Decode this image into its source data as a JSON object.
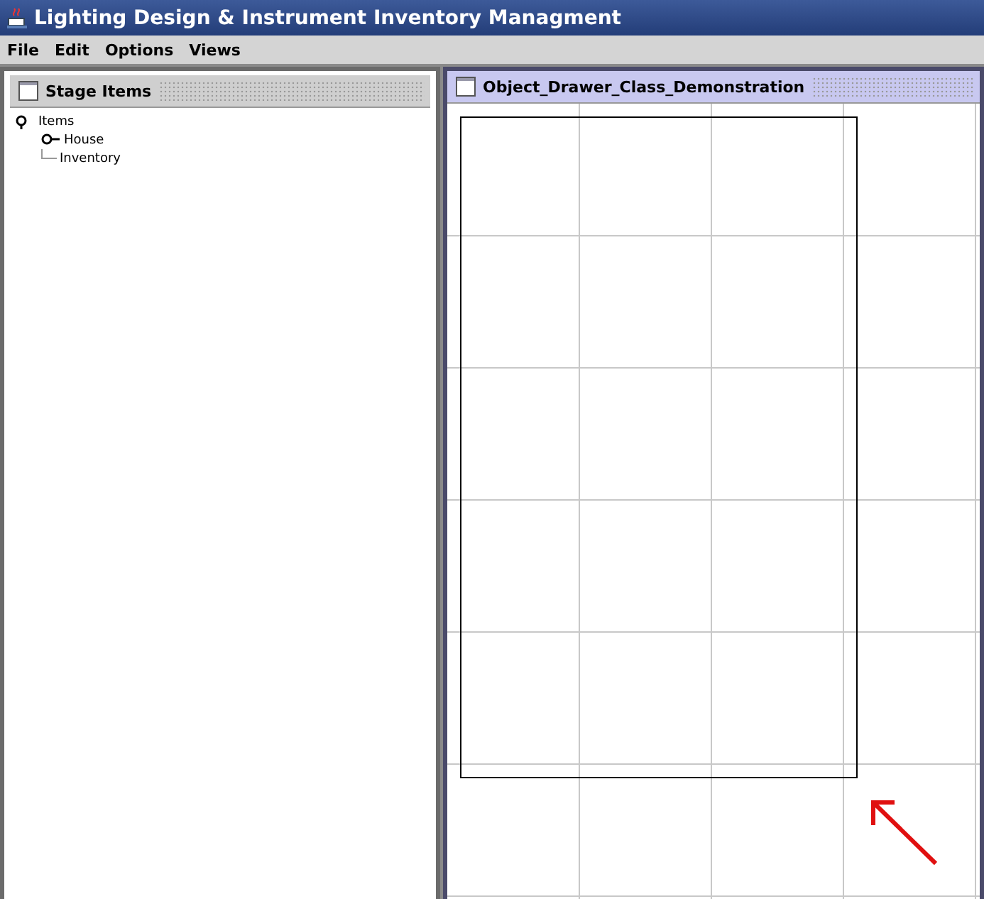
{
  "window": {
    "title": "Lighting Design & Instrument Inventory Managment"
  },
  "menu": [
    {
      "label": "File"
    },
    {
      "label": "Edit"
    },
    {
      "label": "Options"
    },
    {
      "label": "Views"
    }
  ],
  "frames": [
    {
      "title": "Stage Items",
      "selected": false,
      "kind": "tree",
      "tree": [
        {
          "label": "Items",
          "expanded": true,
          "children": [
            {
              "label": "House",
              "expanded": false
            },
            {
              "label": "Inventory"
            }
          ]
        }
      ]
    },
    {
      "title": "Object_Drawer_Class_Demonstration",
      "selected": true,
      "kind": "canvas"
    }
  ]
}
